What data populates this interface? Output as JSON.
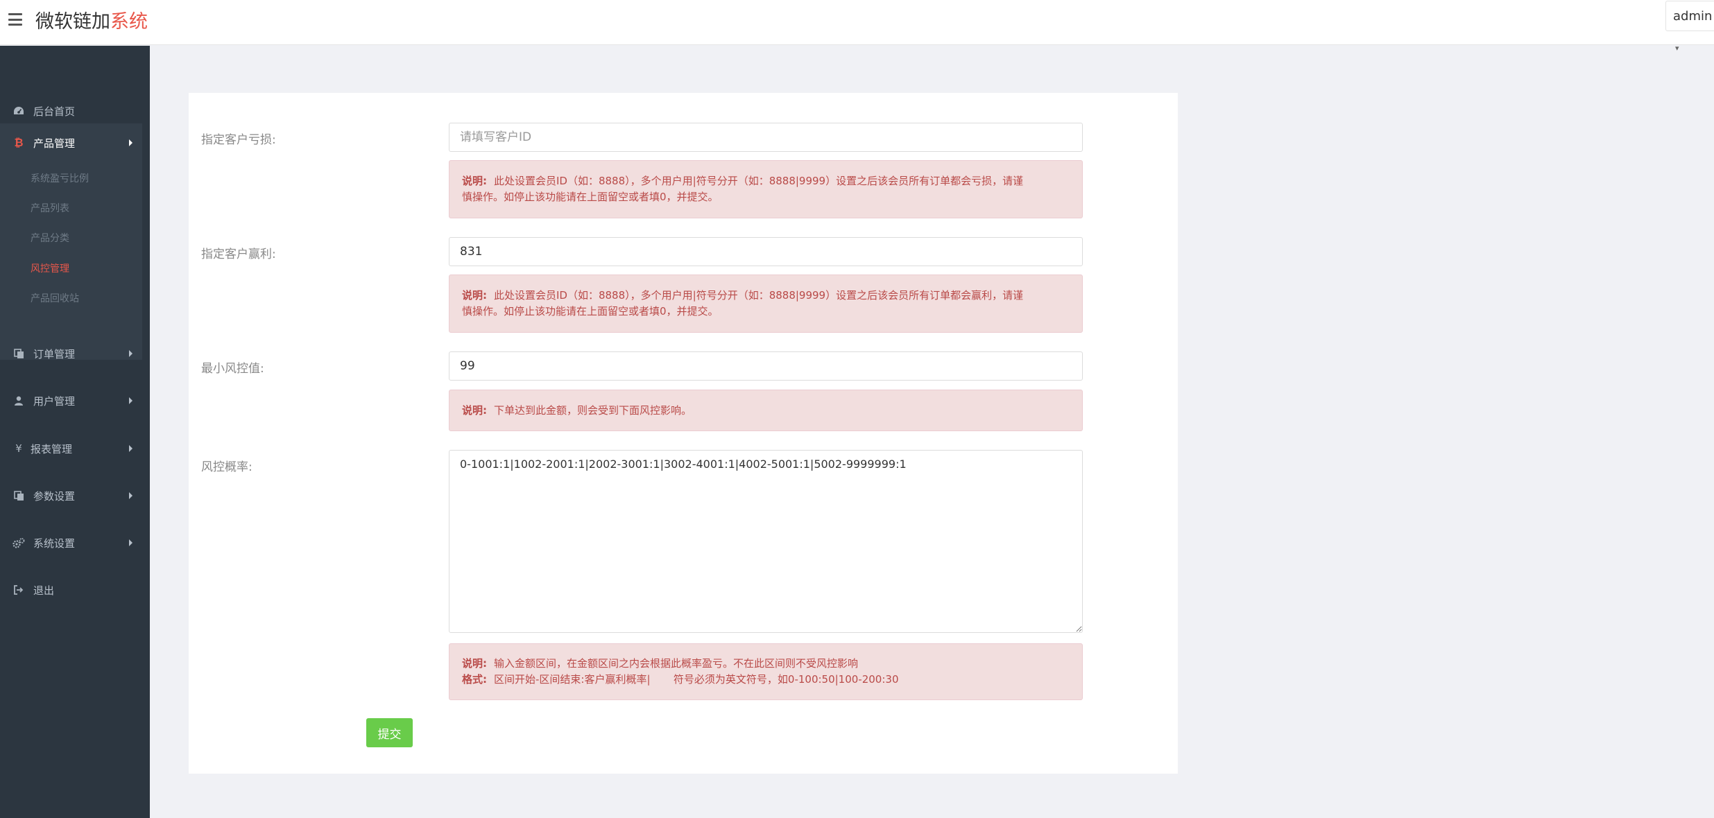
{
  "header": {
    "brand_main": "微软链加",
    "brand_accent": "系统",
    "user_menu": "admin"
  },
  "sidebar": {
    "items": [
      {
        "label": "后台首页",
        "icon": "dashboard-icon"
      },
      {
        "label": "产品管理",
        "icon": "bitcoin-icon",
        "accent": "#e8574a"
      },
      {
        "label": "订单管理",
        "icon": "copy-icon"
      },
      {
        "label": "用户管理",
        "icon": "user-icon"
      },
      {
        "label": "报表管理",
        "icon": "yen-icon"
      },
      {
        "label": "参数设置",
        "icon": "copy-icon"
      },
      {
        "label": "系统设置",
        "icon": "gears-icon"
      },
      {
        "label": "退出",
        "icon": "sign-out-icon"
      }
    ],
    "sub_items": [
      {
        "label": "系统盈亏比例"
      },
      {
        "label": "产品列表"
      },
      {
        "label": "产品分类"
      },
      {
        "label": "风控管理",
        "current": true
      },
      {
        "label": "产品回收站"
      }
    ]
  },
  "form": {
    "loss_label": "指定客户亏损:",
    "loss_placeholder": "请填写客户ID",
    "loss_value": "",
    "loss_note_title": "说明:",
    "loss_note_line1": "此处设置会员ID（如：8888），多个用户用|符号分开（如：8888|9999）设置之后该会员所有订单都会亏损，请谨",
    "loss_note_line2": "慎操作。如停止该功能请在上面留空或者填0，并提交。",
    "win_label": "指定客户赢利:",
    "win_value": "831",
    "win_note_title": "说明:",
    "win_note_line1": "此处设置会员ID（如：8888），多个用户用|符号分开（如：8888|9999）设置之后该会员所有订单都会赢利，请谨",
    "win_note_line2": "慎操作。如停止该功能请在上面留空或者填0，并提交。",
    "min_label": "最小风控值:",
    "min_value": "99",
    "min_note_title": "说明:",
    "min_note": "下单达到此金额，则会受到下面风控影响。",
    "rate_label": "风控概率:",
    "rate_value": "0-1001:1|1002-2001:1|2002-3001:1|3002-4001:1|4002-5001:1|5002-9999999:1",
    "rate_note_title": "说明:",
    "rate_note": "输入金额区间，在金额区间之内会根据此概率盈亏。不在此区间则不受风控影响",
    "format_title": "格式:",
    "format_note": "区间开始-区间结束:客户赢利概率|       符号必须为英文符号，如0-100:50|100-200:30",
    "submit_label": "提交"
  },
  "colors": {
    "accent": "#e8574a",
    "sidebar_bg": "#2c3640",
    "alert_bg": "#f2dede",
    "alert_text": "#b94a48",
    "submit_bg": "#69cc4a"
  }
}
